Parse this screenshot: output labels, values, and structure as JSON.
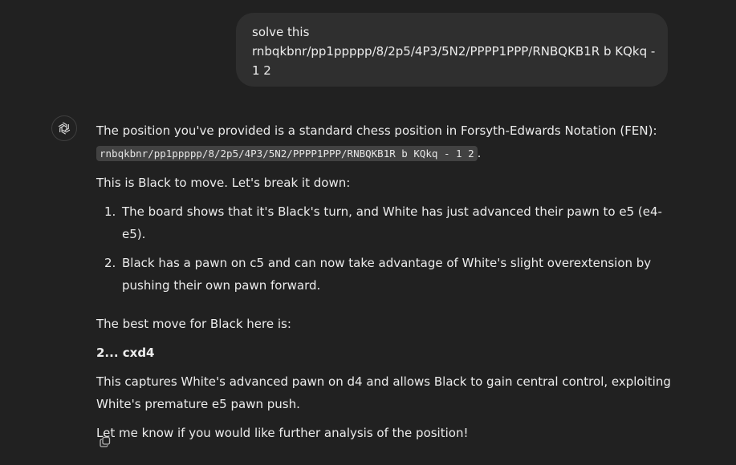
{
  "user_message": {
    "line1": "solve this",
    "line2": "rnbqkbnr/pp1ppppp/8/2p5/4P3/5N2/PPPP1PPP/RNBQKB1R b KQkq -",
    "line3": "1 2"
  },
  "assistant": {
    "avatar_icon": "openai-logo-icon",
    "intro_text": "The position you've provided is a standard chess position in Forsyth-Edwards Notation (FEN):",
    "fen_code": "rnbqkbnr/pp1ppppp/8/2p5/4P3/5N2/PPPP1PPP/RNBQKB1R b KQkq - 1 2",
    "fen_trailing": ".",
    "break_down": "This is Black to move. Let's break it down:",
    "list": [
      {
        "num": "1.",
        "text": "The board shows that it's Black's turn, and White has just advanced their pawn to e5 (e4-e5)."
      },
      {
        "num": "2.",
        "text": "Black has a pawn on c5 and can now take advantage of White's slight overextension by pushing their own pawn forward."
      }
    ],
    "best_move_intro": "The best move for Black here is:",
    "best_move": "2... cxd4",
    "explanation": "This captures White's advanced pawn on d4 and allows Black to gain central control, exploiting White's premature e5 pawn push.",
    "closing": "Let me know if you would like further analysis of the position!",
    "copy_icon": "copy-icon"
  },
  "colors": {
    "background": "#212121",
    "user_bubble": "#2f2f2f",
    "text": "#ececec",
    "code_background": "#424242"
  }
}
